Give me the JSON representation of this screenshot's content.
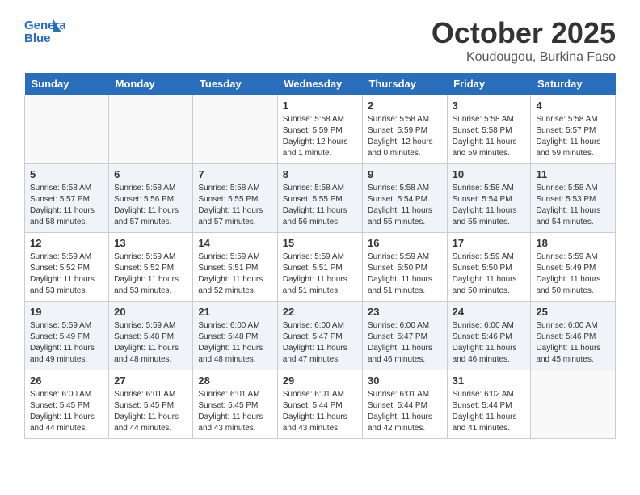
{
  "logo": {
    "general": "General",
    "blue": "Blue"
  },
  "title": "October 2025",
  "location": "Koudougou, Burkina Faso",
  "days_of_week": [
    "Sunday",
    "Monday",
    "Tuesday",
    "Wednesday",
    "Thursday",
    "Friday",
    "Saturday"
  ],
  "weeks": [
    [
      {
        "day": "",
        "info": ""
      },
      {
        "day": "",
        "info": ""
      },
      {
        "day": "",
        "info": ""
      },
      {
        "day": "1",
        "info": "Sunrise: 5:58 AM\nSunset: 5:59 PM\nDaylight: 12 hours\nand 1 minute."
      },
      {
        "day": "2",
        "info": "Sunrise: 5:58 AM\nSunset: 5:59 PM\nDaylight: 12 hours\nand 0 minutes."
      },
      {
        "day": "3",
        "info": "Sunrise: 5:58 AM\nSunset: 5:58 PM\nDaylight: 11 hours\nand 59 minutes."
      },
      {
        "day": "4",
        "info": "Sunrise: 5:58 AM\nSunset: 5:57 PM\nDaylight: 11 hours\nand 59 minutes."
      }
    ],
    [
      {
        "day": "5",
        "info": "Sunrise: 5:58 AM\nSunset: 5:57 PM\nDaylight: 11 hours\nand 58 minutes."
      },
      {
        "day": "6",
        "info": "Sunrise: 5:58 AM\nSunset: 5:56 PM\nDaylight: 11 hours\nand 57 minutes."
      },
      {
        "day": "7",
        "info": "Sunrise: 5:58 AM\nSunset: 5:55 PM\nDaylight: 11 hours\nand 57 minutes."
      },
      {
        "day": "8",
        "info": "Sunrise: 5:58 AM\nSunset: 5:55 PM\nDaylight: 11 hours\nand 56 minutes."
      },
      {
        "day": "9",
        "info": "Sunrise: 5:58 AM\nSunset: 5:54 PM\nDaylight: 11 hours\nand 55 minutes."
      },
      {
        "day": "10",
        "info": "Sunrise: 5:58 AM\nSunset: 5:54 PM\nDaylight: 11 hours\nand 55 minutes."
      },
      {
        "day": "11",
        "info": "Sunrise: 5:58 AM\nSunset: 5:53 PM\nDaylight: 11 hours\nand 54 minutes."
      }
    ],
    [
      {
        "day": "12",
        "info": "Sunrise: 5:59 AM\nSunset: 5:52 PM\nDaylight: 11 hours\nand 53 minutes."
      },
      {
        "day": "13",
        "info": "Sunrise: 5:59 AM\nSunset: 5:52 PM\nDaylight: 11 hours\nand 53 minutes."
      },
      {
        "day": "14",
        "info": "Sunrise: 5:59 AM\nSunset: 5:51 PM\nDaylight: 11 hours\nand 52 minutes."
      },
      {
        "day": "15",
        "info": "Sunrise: 5:59 AM\nSunset: 5:51 PM\nDaylight: 11 hours\nand 51 minutes."
      },
      {
        "day": "16",
        "info": "Sunrise: 5:59 AM\nSunset: 5:50 PM\nDaylight: 11 hours\nand 51 minutes."
      },
      {
        "day": "17",
        "info": "Sunrise: 5:59 AM\nSunset: 5:50 PM\nDaylight: 11 hours\nand 50 minutes."
      },
      {
        "day": "18",
        "info": "Sunrise: 5:59 AM\nSunset: 5:49 PM\nDaylight: 11 hours\nand 50 minutes."
      }
    ],
    [
      {
        "day": "19",
        "info": "Sunrise: 5:59 AM\nSunset: 5:49 PM\nDaylight: 11 hours\nand 49 minutes."
      },
      {
        "day": "20",
        "info": "Sunrise: 5:59 AM\nSunset: 5:48 PM\nDaylight: 11 hours\nand 48 minutes."
      },
      {
        "day": "21",
        "info": "Sunrise: 6:00 AM\nSunset: 5:48 PM\nDaylight: 11 hours\nand 48 minutes."
      },
      {
        "day": "22",
        "info": "Sunrise: 6:00 AM\nSunset: 5:47 PM\nDaylight: 11 hours\nand 47 minutes."
      },
      {
        "day": "23",
        "info": "Sunrise: 6:00 AM\nSunset: 5:47 PM\nDaylight: 11 hours\nand 46 minutes."
      },
      {
        "day": "24",
        "info": "Sunrise: 6:00 AM\nSunset: 5:46 PM\nDaylight: 11 hours\nand 46 minutes."
      },
      {
        "day": "25",
        "info": "Sunrise: 6:00 AM\nSunset: 5:46 PM\nDaylight: 11 hours\nand 45 minutes."
      }
    ],
    [
      {
        "day": "26",
        "info": "Sunrise: 6:00 AM\nSunset: 5:45 PM\nDaylight: 11 hours\nand 44 minutes."
      },
      {
        "day": "27",
        "info": "Sunrise: 6:01 AM\nSunset: 5:45 PM\nDaylight: 11 hours\nand 44 minutes."
      },
      {
        "day": "28",
        "info": "Sunrise: 6:01 AM\nSunset: 5:45 PM\nDaylight: 11 hours\nand 43 minutes."
      },
      {
        "day": "29",
        "info": "Sunrise: 6:01 AM\nSunset: 5:44 PM\nDaylight: 11 hours\nand 43 minutes."
      },
      {
        "day": "30",
        "info": "Sunrise: 6:01 AM\nSunset: 5:44 PM\nDaylight: 11 hours\nand 42 minutes."
      },
      {
        "day": "31",
        "info": "Sunrise: 6:02 AM\nSunset: 5:44 PM\nDaylight: 11 hours\nand 41 minutes."
      },
      {
        "day": "",
        "info": ""
      }
    ]
  ]
}
